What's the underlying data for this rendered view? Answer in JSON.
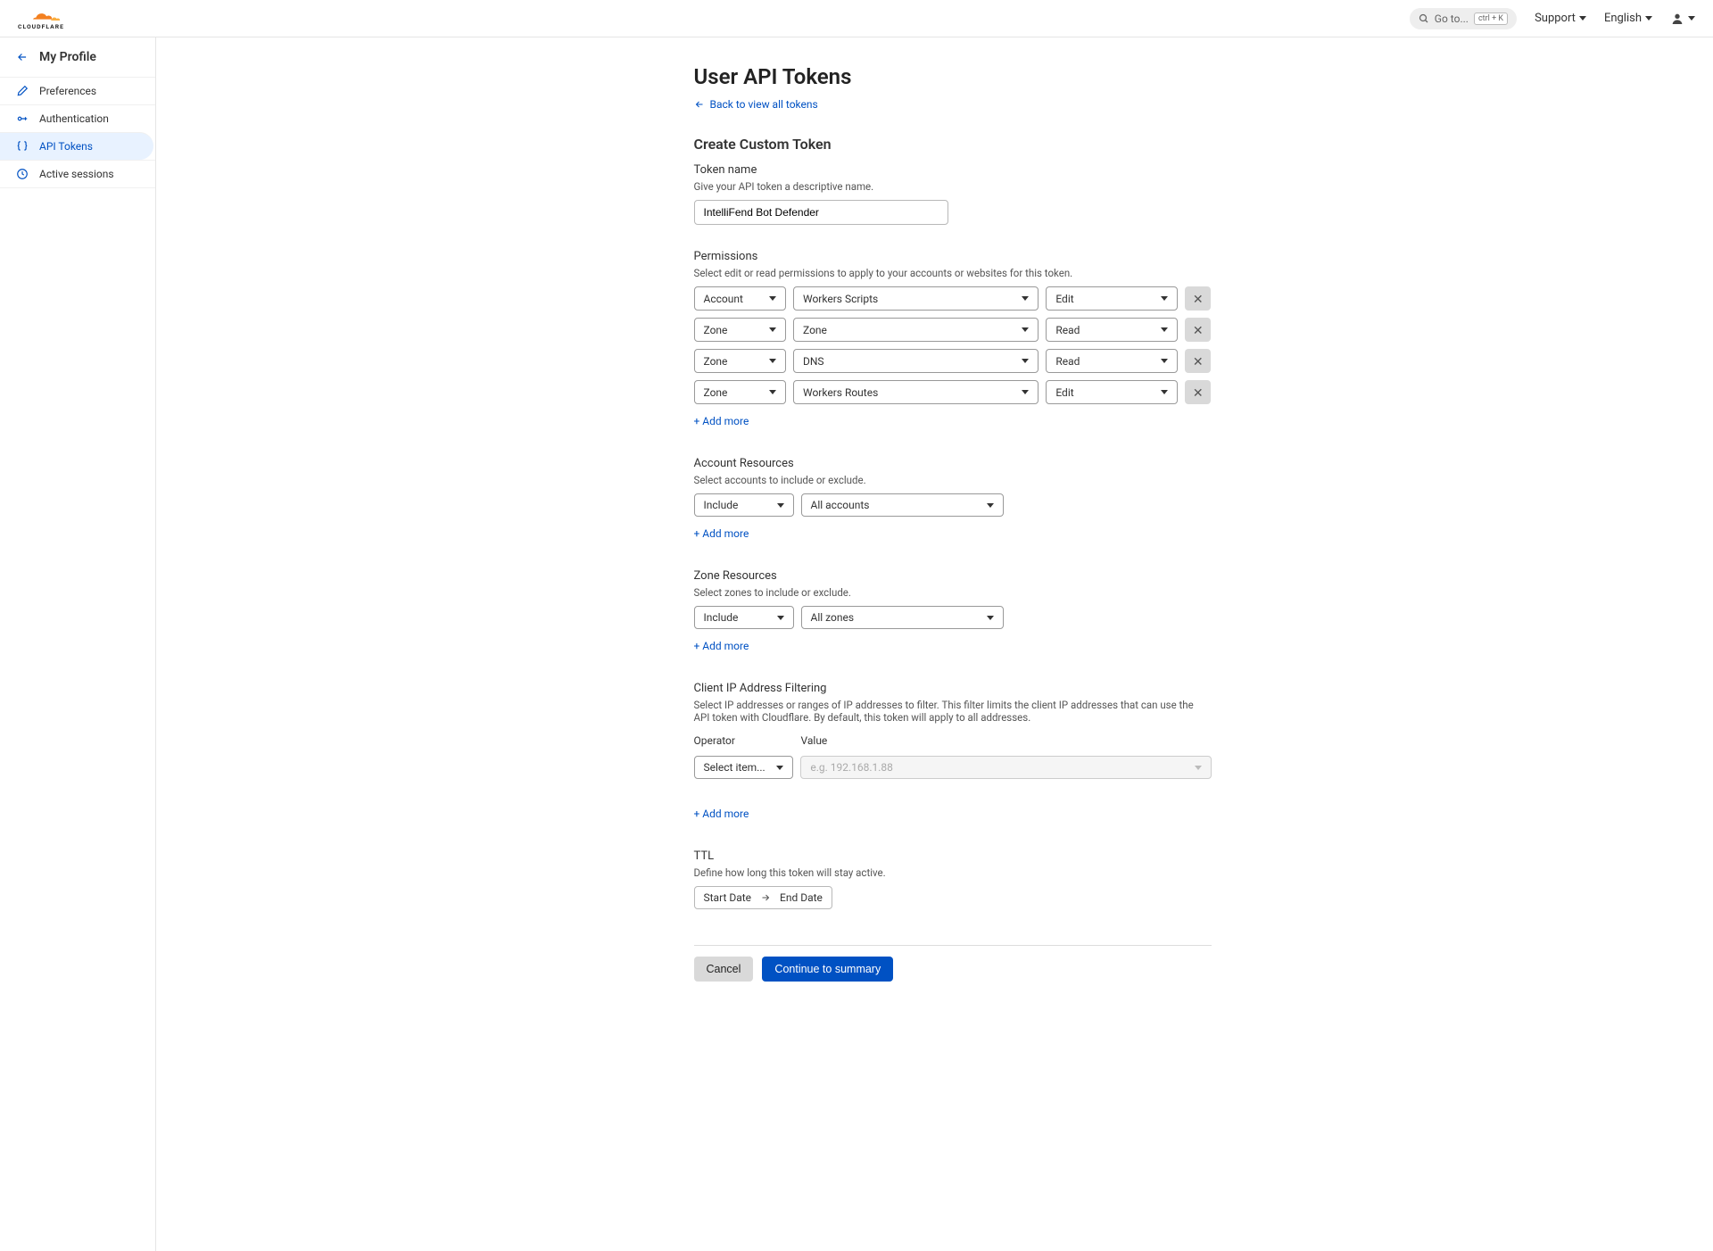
{
  "header": {
    "search_placeholder": "Go to...",
    "search_shortcut": "ctrl + K",
    "support": "Support",
    "language": "English"
  },
  "sidebar": {
    "title": "My Profile",
    "items": [
      {
        "label": "Preferences"
      },
      {
        "label": "Authentication"
      },
      {
        "label": "API Tokens"
      },
      {
        "label": "Active sessions"
      }
    ]
  },
  "page": {
    "title": "User API Tokens",
    "back_link": "Back to view all tokens",
    "section_create": "Create Custom Token",
    "token_name_label": "Token name",
    "token_name_hint": "Give your API token a descriptive name.",
    "token_name_value": "IntelliFend Bot Defender",
    "permissions_label": "Permissions",
    "permissions_hint": "Select edit or read permissions to apply to your accounts or websites for this token.",
    "permissions": [
      {
        "scope": "Account",
        "resource": "Workers Scripts",
        "access": "Edit"
      },
      {
        "scope": "Zone",
        "resource": "Zone",
        "access": "Read"
      },
      {
        "scope": "Zone",
        "resource": "DNS",
        "access": "Read"
      },
      {
        "scope": "Zone",
        "resource": "Workers Routes",
        "access": "Edit"
      }
    ],
    "add_more": "+ Add more",
    "account_resources_label": "Account Resources",
    "account_resources_hint": "Select accounts to include or exclude.",
    "account_include": "Include",
    "account_scope": "All accounts",
    "zone_resources_label": "Zone Resources",
    "zone_resources_hint": "Select zones to include or exclude.",
    "zone_include": "Include",
    "zone_scope": "All zones",
    "ip_filter_label": "Client IP Address Filtering",
    "ip_filter_hint": "Select IP addresses or ranges of IP addresses to filter. This filter limits the client IP addresses that can use the API token with Cloudflare. By default, this token will apply to all addresses.",
    "ip_operator_label": "Operator",
    "ip_value_label": "Value",
    "ip_operator_placeholder": "Select item...",
    "ip_value_placeholder": "e.g. 192.168.1.88",
    "ttl_label": "TTL",
    "ttl_hint": "Define how long this token will stay active.",
    "ttl_start": "Start Date",
    "ttl_end": "End Date",
    "cancel": "Cancel",
    "continue": "Continue to summary"
  }
}
